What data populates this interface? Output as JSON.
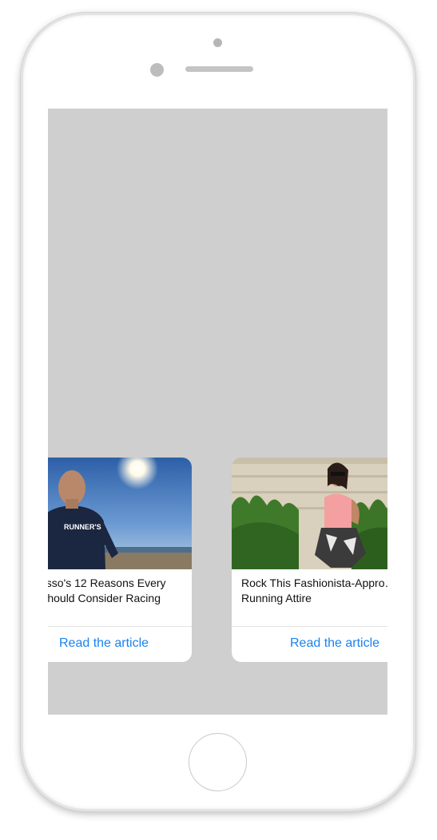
{
  "carousel": {
    "cards": [
      {
        "title_line1": "…asso's 12 Reasons Every",
        "title_line2": "…Should Consider Racing",
        "link_label": "Read the article",
        "image_shirt_text": "RUNNER'S"
      },
      {
        "title_line1": "Rock This Fashionista-Appro…",
        "title_line2": "Running Attire",
        "link_label": "Read the article"
      }
    ]
  },
  "colors": {
    "screen_background": "#cfcfcf",
    "link": "#1a82f0"
  }
}
